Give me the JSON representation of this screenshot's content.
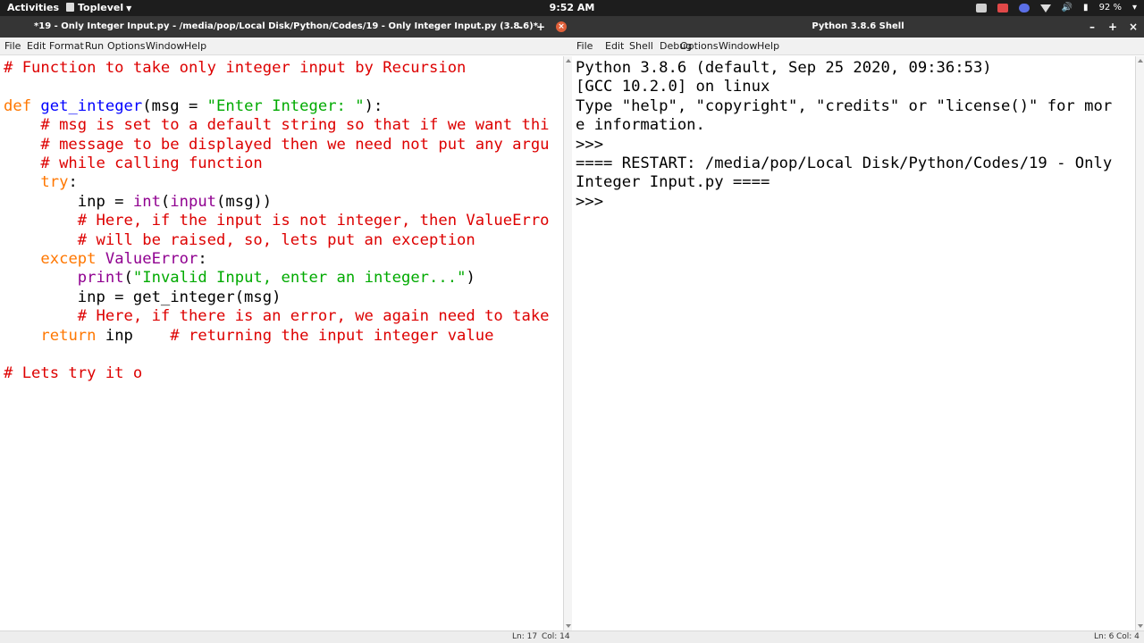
{
  "topbar": {
    "activities": "Activities",
    "app_menu": "Toplevel",
    "clock": "9:52 AM",
    "battery": "92 %"
  },
  "editor": {
    "title": "*19 - Only Integer Input.py - /media/pop/Local Disk/Python/Codes/19 - Only Integer Input.py (3.8.6)*",
    "menu": [
      "File",
      "Edit",
      "Format",
      "Run",
      "Options",
      "Window",
      "Help"
    ],
    "lines": [
      [
        [
          "# Function to take only integer input by Recursion",
          "comment"
        ]
      ],
      [],
      [
        [
          "def ",
          "kw"
        ],
        [
          "get_integer",
          "def"
        ],
        [
          "(msg = ",
          "plain"
        ],
        [
          "\"Enter Integer: \"",
          "str"
        ],
        [
          "):",
          "plain"
        ]
      ],
      [
        [
          "    # msg is set to a default string so that if we want thi",
          "comment"
        ]
      ],
      [
        [
          "    # message to be displayed then we need not put any argu",
          "comment"
        ]
      ],
      [
        [
          "    # while calling function",
          "comment"
        ]
      ],
      [
        [
          "    ",
          "plain"
        ],
        [
          "try",
          "kw"
        ],
        [
          ":",
          "plain"
        ]
      ],
      [
        [
          "        inp = ",
          "plain"
        ],
        [
          "int",
          "builtin"
        ],
        [
          "(",
          "plain"
        ],
        [
          "input",
          "builtin"
        ],
        [
          "(msg))",
          "plain"
        ]
      ],
      [
        [
          "        # Here, if the input is not integer, then ValueErro",
          "comment"
        ]
      ],
      [
        [
          "        # will be raised, so, lets put an exception",
          "comment"
        ]
      ],
      [
        [
          "    ",
          "plain"
        ],
        [
          "except ",
          "kw"
        ],
        [
          "ValueError",
          "builtin"
        ],
        [
          ":",
          "plain"
        ]
      ],
      [
        [
          "        ",
          "plain"
        ],
        [
          "print",
          "builtin"
        ],
        [
          "(",
          "plain"
        ],
        [
          "\"Invalid Input, enter an integer...\"",
          "str"
        ],
        [
          ")",
          "plain"
        ]
      ],
      [
        [
          "        inp = get_integer(msg)",
          "plain"
        ]
      ],
      [
        [
          "        # Here, if there is an error, we again need to take",
          "comment"
        ]
      ],
      [
        [
          "    ",
          "plain"
        ],
        [
          "return ",
          "kw"
        ],
        [
          "inp    ",
          "plain"
        ],
        [
          "# returning the input integer value",
          "comment"
        ]
      ],
      [],
      [
        [
          "# Lets try it o",
          "comment"
        ]
      ]
    ],
    "status": {
      "line": "Ln: 17",
      "col": "Col: 14"
    }
  },
  "shell": {
    "title": "Python 3.8.6 Shell",
    "menu": [
      "File",
      "Edit",
      "Shell",
      "Debug",
      "Options",
      "Window",
      "Help"
    ],
    "lines": [
      [
        [
          "Python 3.8.6 (default, Sep 25 2020, 09:36:53)",
          "plain"
        ]
      ],
      [
        [
          "[GCC 10.2.0] on linux",
          "plain"
        ]
      ],
      [
        [
          "Type \"help\", \"copyright\", \"credits\" or \"license()\" for mor",
          "plain"
        ]
      ],
      [
        [
          "e information.",
          "plain"
        ]
      ],
      [
        [
          ">>> ",
          "plain"
        ]
      ],
      [
        [
          "==== RESTART: /media/pop/Local Disk/Python/Codes/19 - Only",
          "plain"
        ]
      ],
      [
        [
          "Integer Input.py ====",
          "plain"
        ]
      ],
      [
        [
          ">>> ",
          "plain"
        ]
      ]
    ],
    "status": {
      "line": "Ln: 6",
      "col": "Col: 4"
    }
  },
  "colors": {
    "comment": "#dd0000",
    "keyword": "#ff7700",
    "definition": "#0000ff",
    "string": "#00aa00",
    "builtin": "#900090"
  }
}
